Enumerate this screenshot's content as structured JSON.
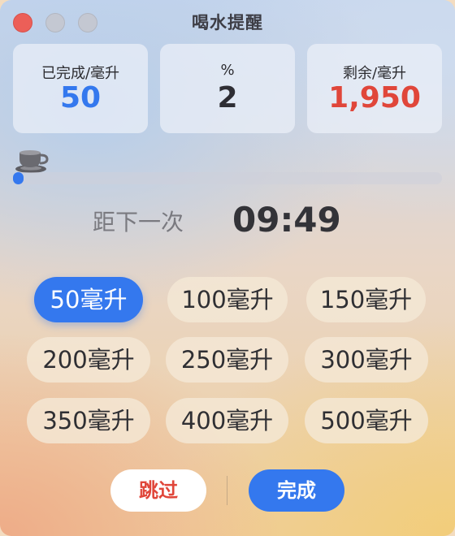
{
  "window": {
    "title": "喝水提醒"
  },
  "stats": {
    "completed": {
      "label": "已完成/毫升",
      "value": "50"
    },
    "percent": {
      "label": "%",
      "value": "2"
    },
    "remaining": {
      "label": "剩余/毫升",
      "value": "1,950"
    }
  },
  "progress": {
    "fraction": 0.025,
    "icon": "coffee-cup-icon",
    "color": "#3478ee"
  },
  "countdown": {
    "label": "距下一次",
    "time": "09:49"
  },
  "amounts": {
    "selected_index": 0,
    "items": [
      "50毫升",
      "100毫升",
      "150毫升",
      "200毫升",
      "250毫升",
      "300毫升",
      "350毫升",
      "400毫升",
      "500毫升"
    ]
  },
  "actions": {
    "skip_label": "跳过",
    "done_label": "完成"
  },
  "colors": {
    "accent": "#3478ee",
    "danger": "#e0463a"
  }
}
